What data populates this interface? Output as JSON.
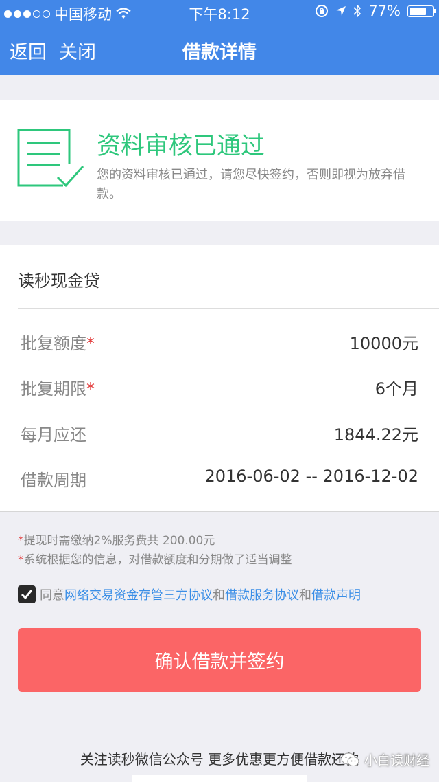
{
  "status_bar": {
    "carrier": "中国移动",
    "time": "下午8:12",
    "battery": "77%",
    "battery_level": 0.77
  },
  "nav": {
    "back": "返回",
    "close": "关闭",
    "title": "借款详情"
  },
  "review": {
    "title": "资料审核已通过",
    "desc": "您的资料审核已通过，请您尽快签约，否则即视为放弃借款。",
    "accent_color": "#2ec77c"
  },
  "loan": {
    "product": "读秒现金贷",
    "rows": [
      {
        "label": "批复额度",
        "star": "*",
        "value": "10000元"
      },
      {
        "label": "批复期限",
        "star": "*",
        "value": "6个月"
      },
      {
        "label": "每月应还",
        "star": "",
        "value": "1844.22元"
      },
      {
        "label": "借款周期",
        "star": "",
        "value": "2016-06-02 -- 2016-12-02"
      }
    ]
  },
  "notes": [
    {
      "star": "*",
      "text": "提现时需缴纳2%服务费共 200.00元"
    },
    {
      "star": "*",
      "text": "系统根据您的信息，对借款额度和分期做了适当调整"
    }
  ],
  "agreement": {
    "checked": true,
    "prefix": "同意",
    "link1": "网络交易资金存管三方协议",
    "and1": "和",
    "link2": "借款服务协议",
    "and2": "和",
    "link3": "借款声明"
  },
  "confirm_button": "确认借款并签约",
  "footer": "关注读秒微信公众号 更多优惠更方便借款还款",
  "watermark": "小白读财经",
  "colors": {
    "nav": "#4287e8",
    "button": "#fb6566",
    "link": "#3a8ee6"
  }
}
